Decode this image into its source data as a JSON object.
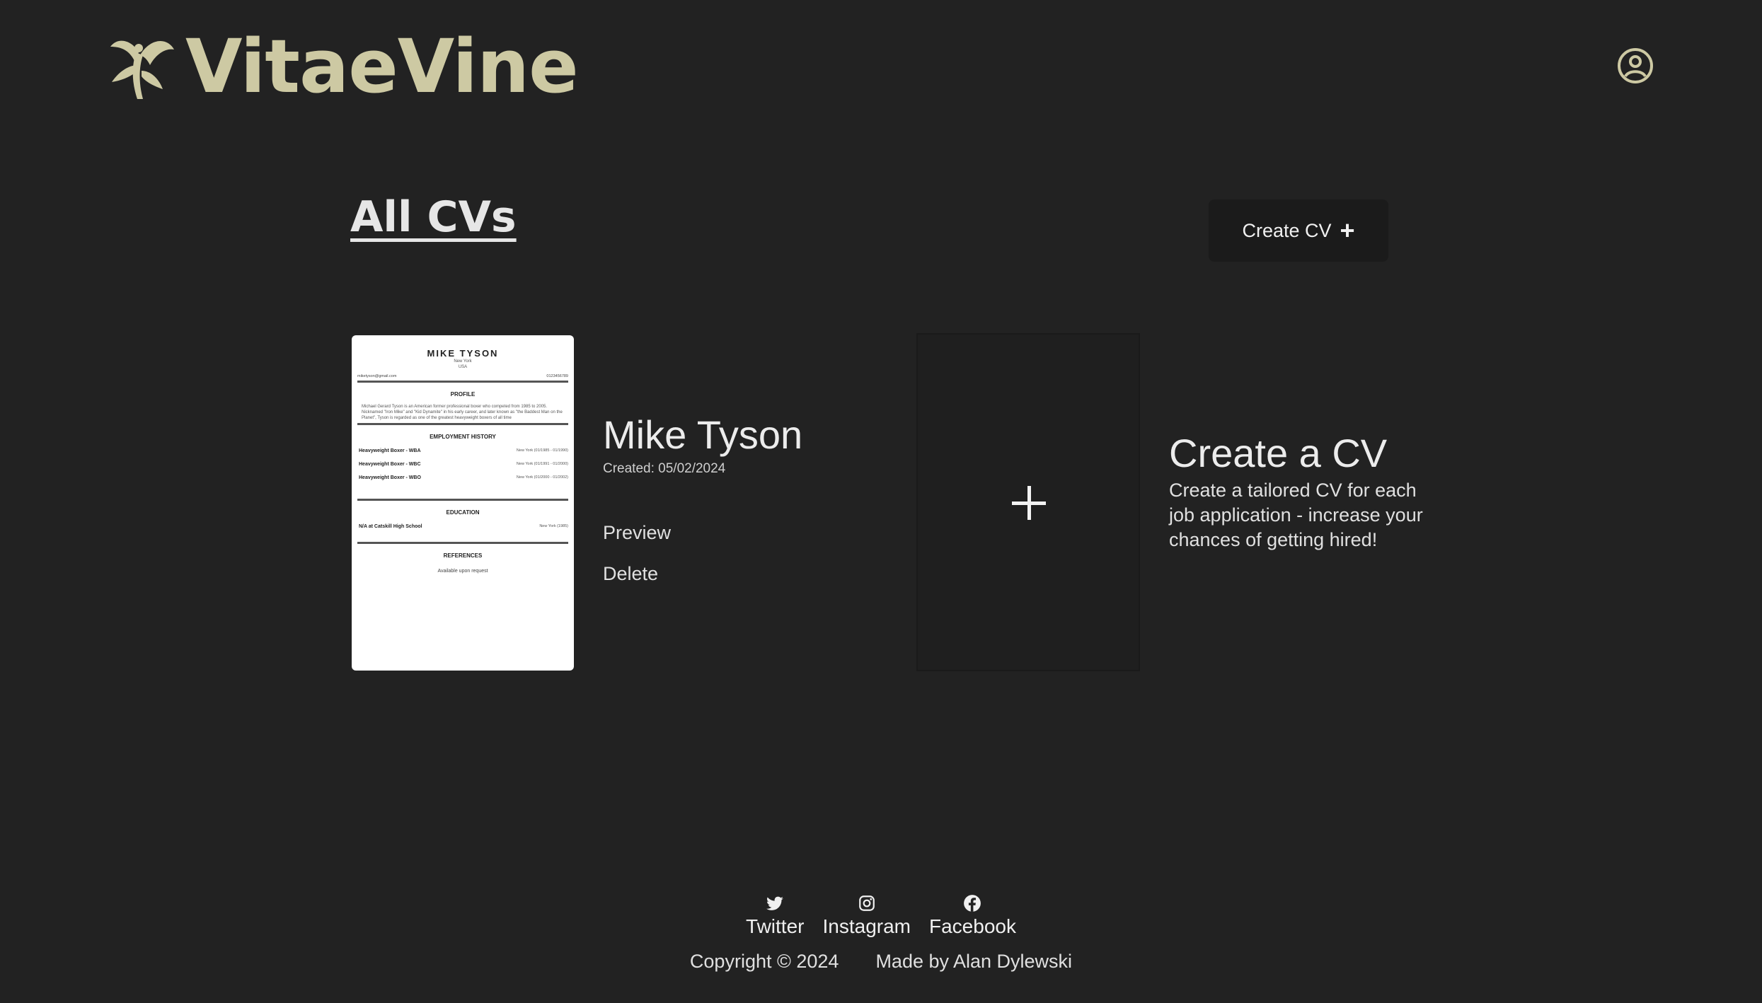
{
  "brand": {
    "name": "VitaeVine",
    "color": "#cdc9a3"
  },
  "header": {
    "account_icon": "user-circle-icon"
  },
  "page": {
    "title": "All CVs",
    "create_button_label": "Create CV"
  },
  "cvs": [
    {
      "title": "Mike Tyson",
      "created": "Created: 05/02/2024",
      "actions": [
        "Preview",
        "Delete"
      ],
      "preview": {
        "name": "MIKE TYSON",
        "city": "New York",
        "country": "USA",
        "email": "miketyson@gmail.com",
        "phone": "0123456789",
        "sections": {
          "profile": "PROFILE",
          "employment": "EMPLOYMENT HISTORY",
          "education": "EDUCATION",
          "references": "REFERENCES"
        },
        "profile_text": "Michael Gerard Tyson is an American former professional boxer who competed from 1985 to 2005. Nicknamed \"Iron Mike\" and \"Kid Dynamite\" in his early career, and later known as \"the Baddest Man on the Planet\", Tyson is regarded as one of the greatest heavyweight boxers of all time",
        "jobs": [
          {
            "title": "Heavyweight Boxer - WBA",
            "detail": "New York (01/1985 - 01/1990)"
          },
          {
            "title": "Heavyweight Boxer - WBC",
            "detail": "New York (01/1991 - 01/2000)"
          },
          {
            "title": "Heavyweight Boxer - WBO",
            "detail": "New York (01/2000 - 01/2002)"
          }
        ],
        "education": [
          {
            "title": "N/A at Catskill High School",
            "detail": "New York (1985)"
          }
        ],
        "references_text": "Available upon request"
      }
    }
  ],
  "create_card": {
    "title": "Create a CV",
    "description": "Create a tailored CV for each job application - increase your chances of getting hired!"
  },
  "footer": {
    "social": [
      {
        "label": "Twitter",
        "icon": "twitter-icon"
      },
      {
        "label": "Instagram",
        "icon": "instagram-icon"
      },
      {
        "label": "Facebook",
        "icon": "facebook-icon"
      }
    ],
    "copyright": "Copyright © 2024",
    "credit": "Made by Alan Dylewski"
  }
}
